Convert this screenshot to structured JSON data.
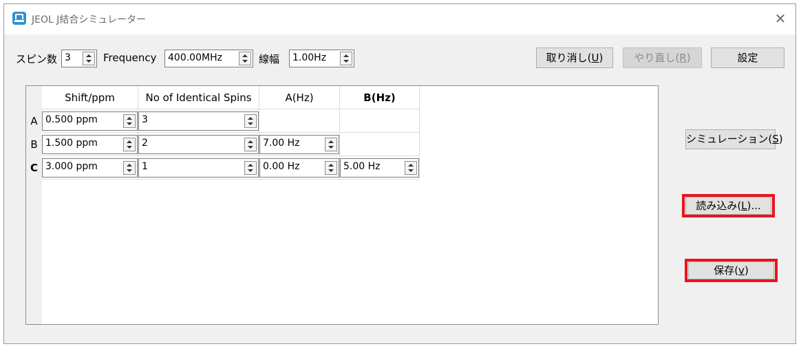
{
  "window": {
    "title": "JEOL J結合シミュレーター",
    "close_glyph": "✕"
  },
  "toolbar": {
    "spin_label": "スピン数",
    "spin_value": "3",
    "frequency_label": "Frequency",
    "frequency_value": "400.00MHz",
    "linewidth_label": "線幅",
    "linewidth_value": "1.00Hz",
    "undo_label": "取り消し(",
    "undo_key": "U",
    "redo_label": "やり直し(",
    "redo_key": "R",
    "close_paren": ")",
    "settings_label": "設定"
  },
  "side": {
    "simulate_label": "シミュレーション(",
    "simulate_key": "S",
    "load_label": "読み込み(",
    "load_key": "L",
    "load_suffix": ")...",
    "save_label": "保存(",
    "save_key": "v",
    "close_paren": ")"
  },
  "grid": {
    "columns": [
      "Shift/ppm",
      "No of Identical Spins",
      "A(Hz)",
      "B(Hz)"
    ],
    "rows": [
      {
        "label": "A",
        "shift": "0.500 ppm",
        "count": "3"
      },
      {
        "label": "B",
        "shift": "1.500 ppm",
        "count": "2",
        "a": "7.00 Hz"
      },
      {
        "label": "C",
        "shift": "3.000 ppm",
        "count": "1",
        "a": "0.00 Hz",
        "b": "5.00 Hz"
      }
    ]
  },
  "colors": {
    "highlight": "#e8141e",
    "window_bg": "#f0f0f0"
  },
  "icons": {
    "app": "jeol-app-icon",
    "close": "close-icon",
    "spinner": "spin-arrows-icon"
  }
}
